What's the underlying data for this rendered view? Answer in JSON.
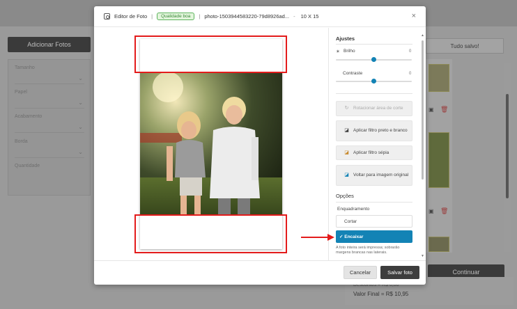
{
  "background": {
    "add_photos": "Adicionar Fotos",
    "filters": [
      "Tamanho",
      "Papel",
      "Acabamento",
      "Borda",
      "Quantidade"
    ],
    "saved": "Tudo salvo!",
    "continue": "Continuar",
    "discount": "Descontos = R$ 0,00",
    "final_value": "Valor Final = R$ 10,95"
  },
  "modal": {
    "title": "Editor de Foto",
    "quality_badge": "Qualidade boa",
    "filename": "photo-1503944583220-79d8926ad...",
    "dash": "-",
    "size": "10 X 15",
    "close": "×"
  },
  "sidebar": {
    "adjust_title": "Ajustes",
    "brightness_label": "Brilho",
    "brightness_value": "0",
    "contrast_label": "Contraste",
    "contrast_value": "0",
    "rotate_crop": "Rotacionar área de corte",
    "bw_filter": "Aplicar filtro preto e branco",
    "sepia_filter": "Aplicar filtro sépia",
    "original": "Voltar para imagem original",
    "options_title": "Opções",
    "framing_label": "Enquadramento",
    "option_crop": "Cortar",
    "option_fit": "✓ Encaixar",
    "fit_note": "A foto inteira será impressa; sobrarão margens brancas nas laterais."
  },
  "footer": {
    "cancel": "Cancelar",
    "save": "Salvar foto"
  },
  "colors": {
    "accent": "#1383b5",
    "highlight": "#e31b1b",
    "save_button": "#3d3d3d"
  }
}
